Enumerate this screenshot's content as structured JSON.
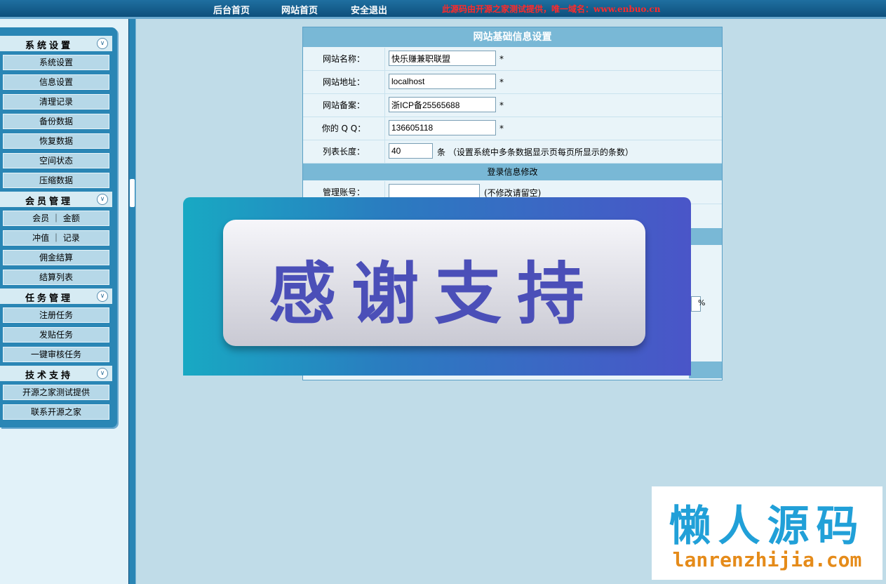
{
  "topbar": {
    "nav": [
      "后台首页",
      "网站首页",
      "安全退出"
    ],
    "notice": "此源码由开源之家测试提供，唯一域名：www.enbuo.cn"
  },
  "sidebar": {
    "sections": [
      {
        "title": "系统设置",
        "items": [
          "系统设置",
          "信息设置",
          "清理记录",
          "备份数据",
          "恢复数据",
          "空间状态",
          "压缩数据"
        ]
      },
      {
        "title": "会员管理",
        "items": [
          "会员 ｜ 金额",
          "冲值 ｜ 记录",
          "佣金结算",
          "结算列表"
        ]
      },
      {
        "title": "任务管理",
        "items": [
          "注册任务",
          "发贴任务",
          "一键审核任务"
        ]
      },
      {
        "title": "技术支持",
        "items": [
          "开源之家测试提供",
          "联系开源之家"
        ]
      }
    ]
  },
  "form": {
    "title": "网站基础信息设置",
    "rows": [
      {
        "label": "网站名称：",
        "value": "快乐赚兼职联盟",
        "star": "*"
      },
      {
        "label": "网站地址：",
        "value": "localhost",
        "star": "*"
      },
      {
        "label": "网站备案：",
        "value": "浙ICP备25565688",
        "star": "*"
      },
      {
        "label": "你的 Q Q：",
        "value": "136605118",
        "star": "*"
      }
    ],
    "list_length": {
      "label": "列表长度：",
      "value": "40",
      "hint": "条 （设置系统中多条数据显示页每页所显示的条数）"
    },
    "login_section_title": "登录信息修改",
    "admin_account": {
      "label": "管理账号：",
      "value": "",
      "hint": "(不修改请留空)"
    },
    "percent_symbol": "%"
  },
  "banner": {
    "text": "感谢支持"
  },
  "watermark": {
    "line1": "懒人源码",
    "line2": "lanrenzhijia.com"
  }
}
